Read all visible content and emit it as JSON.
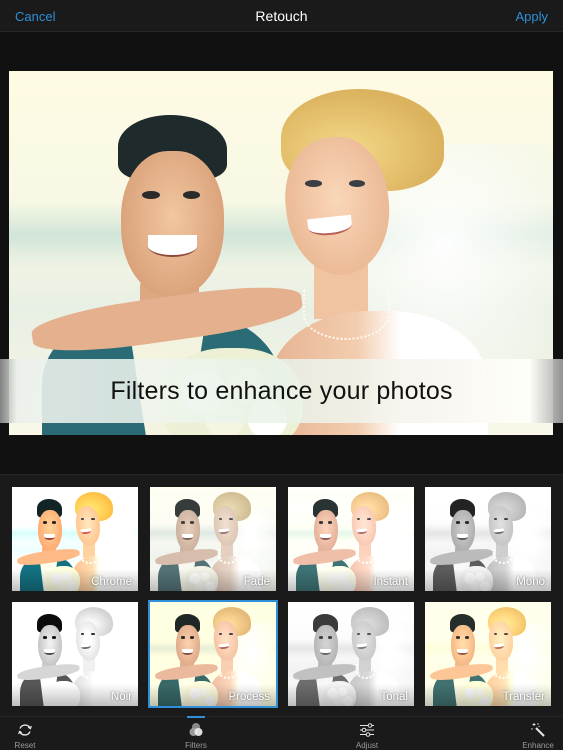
{
  "navbar": {
    "cancel_label": "Cancel",
    "title": "Retouch",
    "apply_label": "Apply"
  },
  "photo": {
    "caption": "Filters to enhance your photos"
  },
  "filters": {
    "selected": "Process",
    "items": [
      {
        "label": "Chrome"
      },
      {
        "label": "Fade"
      },
      {
        "label": "Instant"
      },
      {
        "label": "Mono"
      },
      {
        "label": "Noir"
      },
      {
        "label": "Process"
      },
      {
        "label": "Tonal"
      },
      {
        "label": "Transfer"
      }
    ]
  },
  "toolbar": {
    "active": "Filters",
    "items": [
      {
        "label": "Reset",
        "icon": "reset-icon"
      },
      {
        "label": "Filters",
        "icon": "filters-icon"
      },
      {
        "label": "Adjust",
        "icon": "sliders-icon"
      },
      {
        "label": "Enhance",
        "icon": "magic-wand-icon"
      }
    ]
  },
  "colors": {
    "accent": "#2f8fd8",
    "background": "#111111",
    "bar": "#1a1a1a"
  }
}
